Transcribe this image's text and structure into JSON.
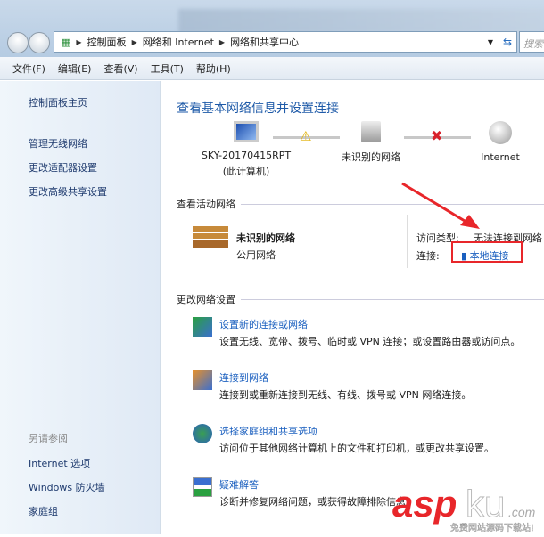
{
  "window": {
    "breadcrumb": [
      "控制面板",
      "网络和 Internet",
      "网络和共享中心"
    ],
    "search_placeholder": "搜索"
  },
  "menu": [
    "文件(F)",
    "编辑(E)",
    "查看(V)",
    "工具(T)",
    "帮助(H)"
  ],
  "sidebar": {
    "items": [
      "控制面板主页",
      "管理无线网络",
      "更改适配器设置",
      "更改高级共享设置"
    ],
    "see_also_title": "另请参阅",
    "see_also": [
      "Internet 选项",
      "Windows 防火墙",
      "家庭组"
    ]
  },
  "main": {
    "title": "查看基本网络信息并设置连接",
    "map": {
      "computer_name": "SKY-20170415RPT",
      "computer_sub": "(此计算机)",
      "network": "未识别的网络",
      "internet": "Internet"
    },
    "active_section": "查看活动网络",
    "active": {
      "name": "未识别的网络",
      "type": "公用网络",
      "access_label": "访问类型:",
      "access_value": "无法连接到网络",
      "conn_label": "连接:",
      "conn_value": "本地连接"
    },
    "change_section": "更改网络设置",
    "tasks": [
      {
        "link": "设置新的连接或网络",
        "desc": "设置无线、宽带、拨号、临时或 VPN 连接；或设置路由器或访问点。"
      },
      {
        "link": "连接到网络",
        "desc": "连接到或重新连接到无线、有线、拨号或 VPN 网络连接。"
      },
      {
        "link": "选择家庭组和共享选项",
        "desc": "访问位于其他网络计算机上的文件和打印机，或更改共享设置。"
      },
      {
        "link": "疑难解答",
        "desc": "诊断并修复网络问题，或获得故障排除信息。"
      }
    ]
  },
  "watermark": {
    "brand": "aspku.com",
    "tagline": "免费网站源码下载站!"
  },
  "colors": {
    "link": "#1a5fbf",
    "highlight": "#e8262a"
  }
}
